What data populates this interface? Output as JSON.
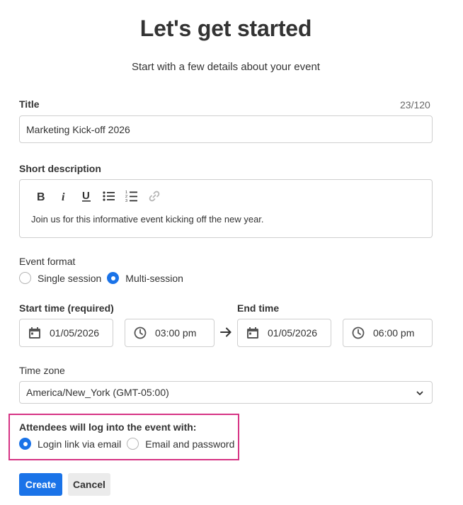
{
  "header": {
    "title": "Let's get started",
    "subtitle": "Start with a few details about your event"
  },
  "title_field": {
    "label": "Title",
    "counter": "23/120",
    "value": "Marketing Kick-off 2026"
  },
  "description": {
    "label": "Short description",
    "toolbar": [
      "bold-icon",
      "italic-icon",
      "underline-icon",
      "bulleted-list-icon",
      "numbered-list-icon",
      "link-icon"
    ],
    "text": "Join us for this informative event kicking off the new year."
  },
  "event_format": {
    "label": "Event format",
    "options": [
      "Single session",
      "Multi-session"
    ],
    "selected": "Multi-session"
  },
  "start_time": {
    "label": "Start time (required)",
    "date": "01/05/2026",
    "time": "03:00 pm"
  },
  "end_time": {
    "label": "End time",
    "date": "01/05/2026",
    "time": "06:00 pm"
  },
  "time_zone": {
    "label": "Time zone",
    "value": "America/New_York (GMT-05:00)"
  },
  "login_method": {
    "label": "Attendees will log into the event with:",
    "options": [
      "Login link via email",
      "Email and password"
    ],
    "selected": "Login link via email",
    "highlight_color": "#d63384"
  },
  "actions": {
    "create_label": "Create",
    "cancel_label": "Cancel"
  },
  "colors": {
    "primary": "#1a73e8",
    "border": "#cfcfcf",
    "text": "#333333"
  }
}
